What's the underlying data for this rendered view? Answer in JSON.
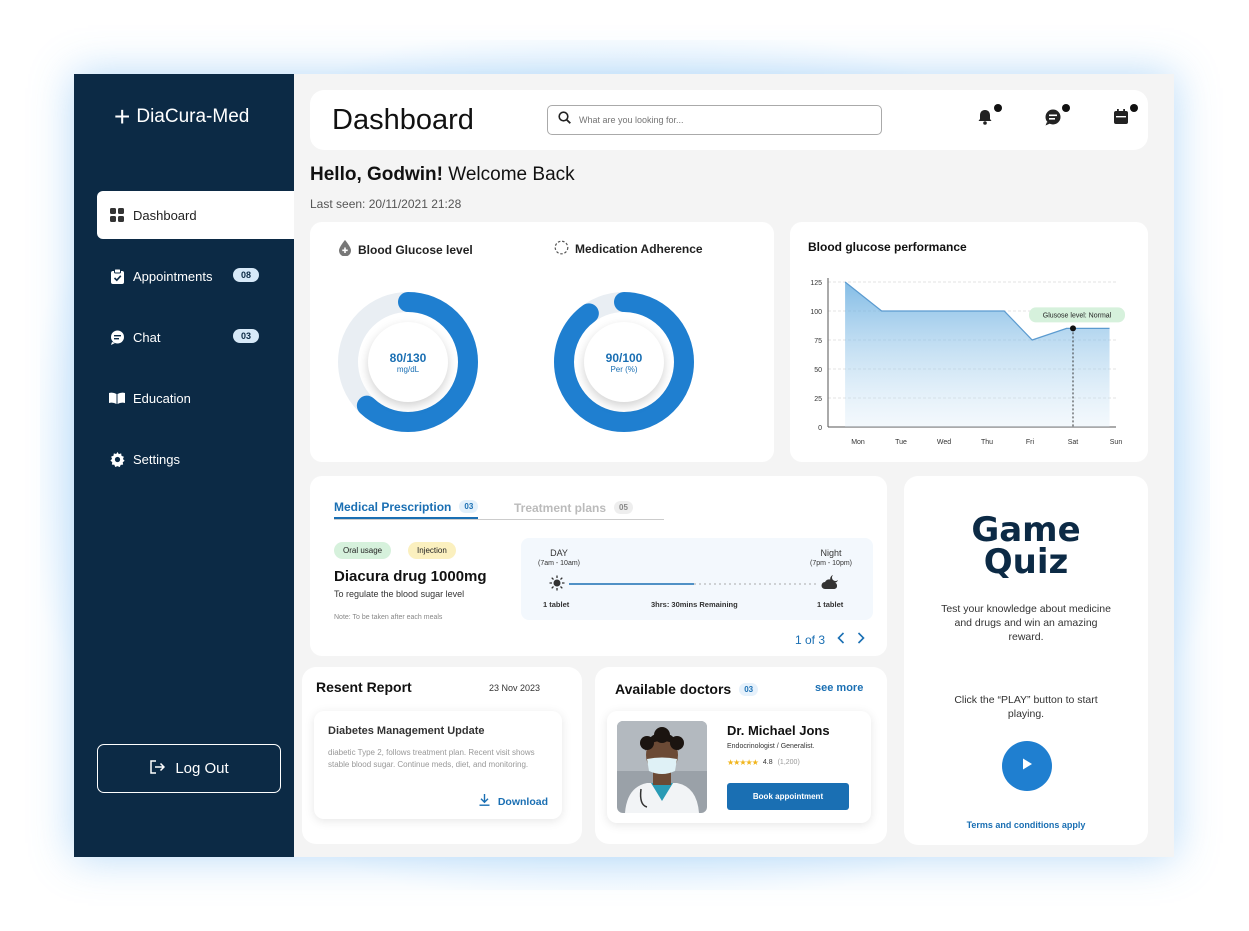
{
  "app": {
    "brand": "DiaCura-Med"
  },
  "sidebar": {
    "items": [
      {
        "label": "Dashboard",
        "badge": ""
      },
      {
        "label": "Appointments",
        "badge": "08"
      },
      {
        "label": "Chat",
        "badge": "03"
      },
      {
        "label": "Education",
        "badge": ""
      },
      {
        "label": "Settings",
        "badge": ""
      }
    ],
    "logout_label": "Log Out"
  },
  "header": {
    "title": "Dashboard",
    "search_placeholder": "What are you looking for..."
  },
  "greeting": {
    "hello": "Hello, Godwin!",
    "welcome": " Welcome Back",
    "last_seen": "Last seen: 20/11/2021 21:28"
  },
  "glucose_ring": {
    "title": "Blood Glucose level",
    "value": "80/130",
    "unit": "mg/dL",
    "fraction": 0.62
  },
  "adherence_ring": {
    "title": "Medication Adherence",
    "value": "90/100",
    "unit": "Per (%)",
    "fraction": 0.9
  },
  "performance": {
    "title": "Blood glucose performance",
    "tooltip": "Glusose level: Normal"
  },
  "chart_data": {
    "type": "area",
    "title": "Blood glucose performance",
    "categories": [
      "Mon",
      "Tue",
      "Wed",
      "Thu",
      "Fri",
      "Sat",
      "Sun"
    ],
    "x": [
      0,
      1,
      2,
      3,
      4,
      5,
      6
    ],
    "points_x": [
      0,
      0.85,
      1.6,
      2.35,
      3.1,
      3.55,
      4.0,
      4.85,
      5.9
    ],
    "points_y": [
      125,
      115,
      100,
      100,
      100,
      100,
      90,
      75,
      85,
      85,
      85
    ],
    "series": [
      {
        "name": "",
        "x": [
          -0.3,
          0.55,
          1.55,
          2.55,
          3.4,
          4.05,
          4.85,
          5.5,
          5.85
        ],
        "values": [
          125,
          100,
          100,
          100,
          100,
          75,
          85,
          85,
          85
        ]
      }
    ],
    "yticks": [
      0,
      25,
      50,
      75,
      100,
      125
    ],
    "ylim": [
      0,
      125
    ],
    "grid": true,
    "highlight": {
      "category": "Sat",
      "value": 85
    }
  },
  "prescription": {
    "tabs": [
      {
        "label": "Medical Prescription",
        "count": "03"
      },
      {
        "label": "Treatment plans",
        "count": "05"
      }
    ],
    "pills": [
      "Oral usage",
      "Injection"
    ],
    "drug": "Diacura drug 1000mg",
    "description": "To regulate the blood sugar level",
    "note": "Note: To be taken after each meals",
    "day_label": "DAY",
    "day_time": "(7am - 10am)",
    "night_label": "Night",
    "night_time": "(7pm - 10pm)",
    "day_dose": "1 tablet",
    "remaining": "3hrs: 30mins Remaining",
    "night_dose": "1 tablet",
    "progress": 0.5,
    "pager": "1 of 3"
  },
  "quiz": {
    "title_1": "Game",
    "title_2": "Quiz",
    "desc": "Test your knowledge about medicine and drugs and win an amazing reward.",
    "cta": "Click the “PLAY” button to start playing.",
    "terms": "Terms and conditions apply"
  },
  "report": {
    "title": "Resent Report",
    "date": "23 Nov 2023",
    "item_title": "Diabetes Management Update",
    "item_text": "diabetic Type 2, follows treatment plan. Recent visit shows stable blood sugar. Continue meds, diet, and monitoring.",
    "download": "Download"
  },
  "doctors": {
    "title": "Available doctors",
    "count": "03",
    "see_more": "see more",
    "name": "Dr. Michael Jons",
    "specialty": "Endocrinologist / Generalist.",
    "rating": "4.8",
    "reviews": "(1,200)",
    "stars": "★★★★★",
    "book": "Book appointment"
  },
  "colors": {
    "navy": "#0c2a45",
    "accent": "#1a6fb3",
    "ring": "#1f7fd0"
  }
}
